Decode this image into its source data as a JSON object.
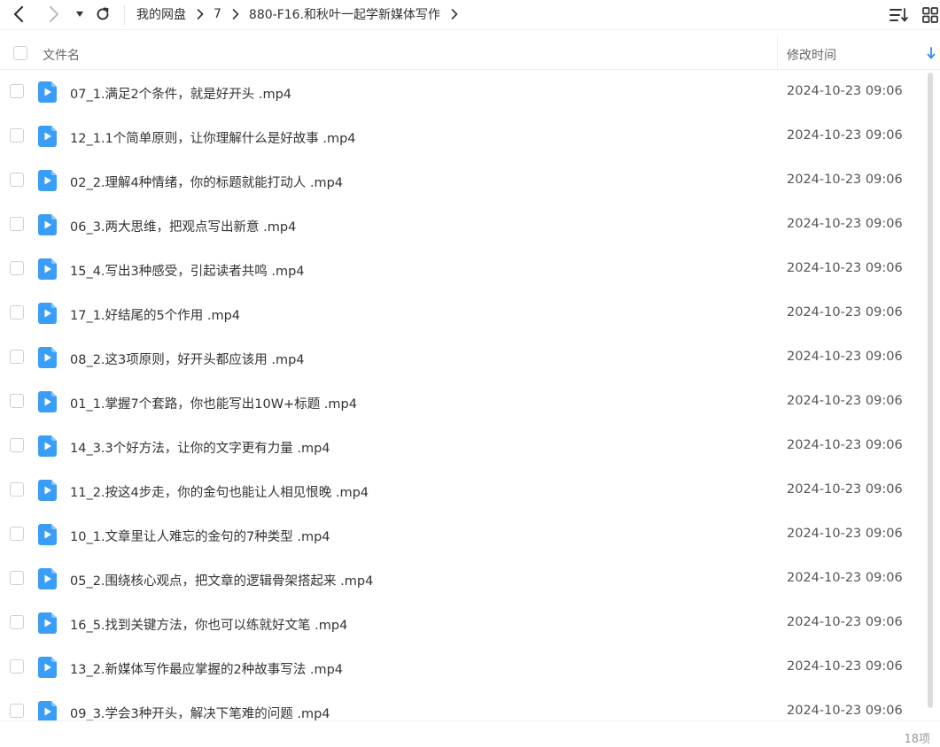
{
  "breadcrumb": [
    "我的网盘",
    "7",
    "880-F16.和秋叶一起学新媒体写作"
  ],
  "header": {
    "name_label": "文件名",
    "time_label": "修改时间"
  },
  "files": [
    {
      "name": "07_1.满足2个条件，就是好开头 .mp4",
      "time": "2024-10-23 09:06"
    },
    {
      "name": "12_1.1个简单原则，让你理解什么是好故事 .mp4",
      "time": "2024-10-23 09:06"
    },
    {
      "name": "02_2.理解4种情绪，你的标题就能打动人 .mp4",
      "time": "2024-10-23 09:06"
    },
    {
      "name": "06_3.两大思维，把观点写出新意 .mp4",
      "time": "2024-10-23 09:06"
    },
    {
      "name": "15_4.写出3种感受，引起读者共鸣 .mp4",
      "time": "2024-10-23 09:06"
    },
    {
      "name": "17_1.好结尾的5个作用 .mp4",
      "time": "2024-10-23 09:06"
    },
    {
      "name": "08_2.这3项原则，好开头都应该用 .mp4",
      "time": "2024-10-23 09:06"
    },
    {
      "name": "01_1.掌握7个套路，你也能写出10W+标题 .mp4",
      "time": "2024-10-23 09:06"
    },
    {
      "name": "14_3.3个好方法，让你的文字更有力量 .mp4",
      "time": "2024-10-23 09:06"
    },
    {
      "name": "11_2.按这4步走，你的金句也能让人相见恨晚 .mp4",
      "time": "2024-10-23 09:06"
    },
    {
      "name": "10_1.文章里让人难忘的金句的7种类型 .mp4",
      "time": "2024-10-23 09:06"
    },
    {
      "name": "05_2.围绕核心观点，把文章的逻辑骨架搭起来 .mp4",
      "time": "2024-10-23 09:06"
    },
    {
      "name": "16_5.找到关键方法，你也可以练就好文笔 .mp4",
      "time": "2024-10-23 09:06"
    },
    {
      "name": "13_2.新媒体写作最应掌握的2种故事写法 .mp4",
      "time": "2024-10-23 09:06"
    },
    {
      "name": "09_3.学会3种开头，解决下笔难的问题 .mp4",
      "time": "2024-10-23 09:06"
    }
  ],
  "footer": {
    "count": "18项"
  },
  "colors": {
    "accent": "#2f8ff5",
    "icon_blue": "#3a9df8"
  }
}
